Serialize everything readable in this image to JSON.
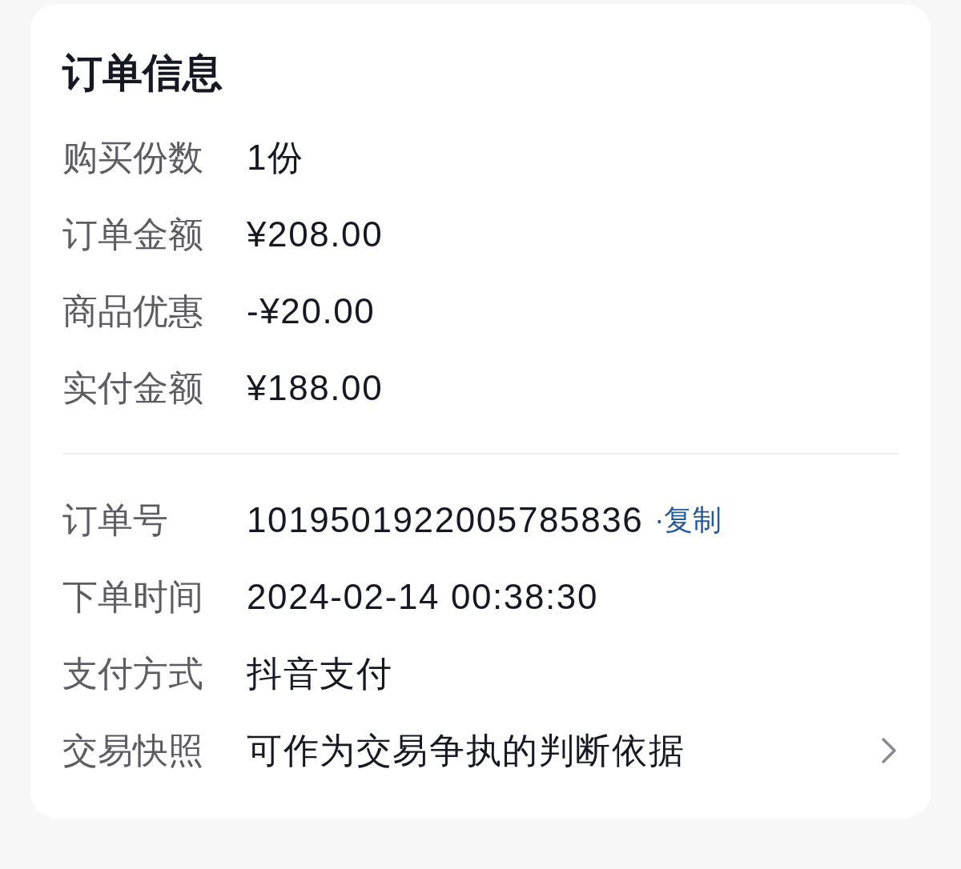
{
  "card": {
    "title": "订单信息",
    "sections": [
      {
        "rows": [
          {
            "kind": "plain",
            "label": "购买份数",
            "value": "1份"
          },
          {
            "kind": "plain",
            "label": "订单金额",
            "value": "¥208.00"
          },
          {
            "kind": "plain",
            "label": "商品优惠",
            "value": "-¥20.00"
          },
          {
            "kind": "plain",
            "label": "实付金额",
            "value": "¥188.00"
          }
        ]
      },
      {
        "rows": [
          {
            "kind": "copy",
            "label": "订单号",
            "value": "1019501922005785836",
            "action": "·复制"
          },
          {
            "kind": "plain",
            "label": "下单时间",
            "value": "2024-02-14 00:38:30"
          },
          {
            "kind": "plain",
            "label": "支付方式",
            "value": "抖音支付"
          },
          {
            "kind": "nav",
            "label": "交易快照",
            "value": "可作为交易争执的判断依据"
          }
        ]
      }
    ]
  }
}
